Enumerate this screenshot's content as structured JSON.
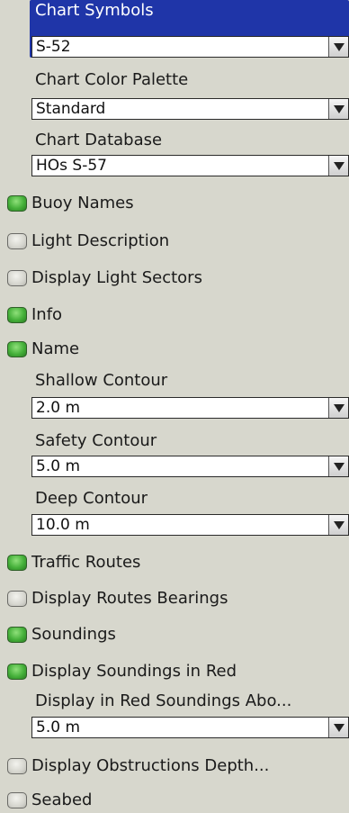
{
  "settings": {
    "chart_symbols": {
      "label": "Chart Symbols",
      "value": "S-52"
    },
    "chart_color_palette": {
      "label": "Chart Color Palette",
      "value": "Standard"
    },
    "chart_database": {
      "label": "Chart Database",
      "value": "HOs S-57"
    },
    "buoy_names": {
      "label": "Buoy Names",
      "state": "on"
    },
    "light_description": {
      "label": "Light Description",
      "state": "off"
    },
    "display_light_sectors": {
      "label": "Display Light Sectors",
      "state": "off"
    },
    "info": {
      "label": "Info",
      "state": "on"
    },
    "name": {
      "label": "Name",
      "state": "on"
    },
    "shallow_contour": {
      "label": "Shallow Contour",
      "value": "2.0 m"
    },
    "safety_contour": {
      "label": "Safety Contour",
      "value": "5.0 m"
    },
    "deep_contour": {
      "label": "Deep Contour",
      "value": "10.0 m"
    },
    "traffic_routes": {
      "label": "Traffic Routes",
      "state": "on"
    },
    "display_routes_bearings": {
      "label": "Display Routes Bearings",
      "state": "off"
    },
    "soundings": {
      "label": "Soundings",
      "state": "on"
    },
    "display_soundings_in_red": {
      "label": "Display Soundings in Red",
      "state": "on"
    },
    "display_red_soundings_above": {
      "label": "Display in Red Soundings Abo...",
      "value": "5.0 m"
    },
    "display_obstructions_depth": {
      "label": "Display Obstructions Depth...",
      "state": "off"
    },
    "seabed": {
      "label": "Seabed",
      "state": "off"
    }
  },
  "colors": {
    "panel_bg": "#d7d7cd",
    "selection": "#1f35a8",
    "led_on": "#45b03a",
    "led_off": "#d6d6cf"
  },
  "icons": {
    "dropdown": "chevron-down-icon",
    "toggle_on": "green-led-indicator-icon",
    "toggle_off": "gray-led-indicator-icon"
  }
}
